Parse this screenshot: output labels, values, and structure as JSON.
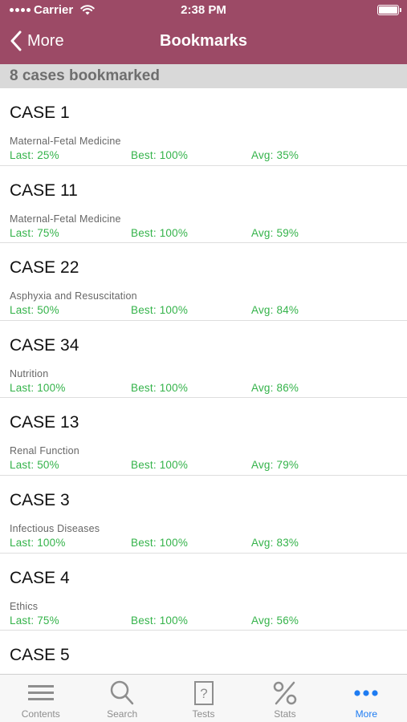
{
  "status_bar": {
    "carrier": "Carrier",
    "time": "2:38 PM"
  },
  "nav": {
    "back_label": "More",
    "title": "Bookmarks"
  },
  "summary": {
    "count_label": "8 cases bookmarked"
  },
  "colors": {
    "header": "#9c4a66",
    "stat_green": "#34b34a",
    "active_tab": "#1e7cf2"
  },
  "cases": [
    {
      "title": "CASE 1",
      "category": "Maternal-Fetal Medicine",
      "last": "Last: 25%",
      "best": "Best: 100%",
      "avg": "Avg: 35%"
    },
    {
      "title": "CASE 11",
      "category": "Maternal-Fetal Medicine",
      "last": "Last: 75%",
      "best": "Best: 100%",
      "avg": "Avg: 59%"
    },
    {
      "title": "CASE 22",
      "category": "Asphyxia and Resuscitation",
      "last": "Last: 50%",
      "best": "Best: 100%",
      "avg": "Avg: 84%"
    },
    {
      "title": "CASE 34",
      "category": "Nutrition",
      "last": "Last: 100%",
      "best": "Best: 100%",
      "avg": "Avg: 86%"
    },
    {
      "title": "CASE 13",
      "category": "Renal Function",
      "last": "Last: 50%",
      "best": "Best: 100%",
      "avg": "Avg: 79%"
    },
    {
      "title": "CASE 3",
      "category": "Infectious Diseases",
      "last": "Last: 100%",
      "best": "Best: 100%",
      "avg": "Avg: 83%"
    },
    {
      "title": "CASE 4",
      "category": "Ethics",
      "last": "Last: 75%",
      "best": "Best: 100%",
      "avg": "Avg: 56%"
    },
    {
      "title": "CASE 5",
      "category": "",
      "last": "",
      "best": "",
      "avg": ""
    }
  ],
  "tabs": [
    {
      "label": "Contents",
      "icon": "menu-lines-icon",
      "active": false
    },
    {
      "label": "Search",
      "icon": "magnifier-icon",
      "active": false
    },
    {
      "label": "Tests",
      "icon": "question-scroll-icon",
      "active": false
    },
    {
      "label": "Stats",
      "icon": "percent-icon",
      "active": false
    },
    {
      "label": "More",
      "icon": "more-dots-icon",
      "active": true
    }
  ]
}
